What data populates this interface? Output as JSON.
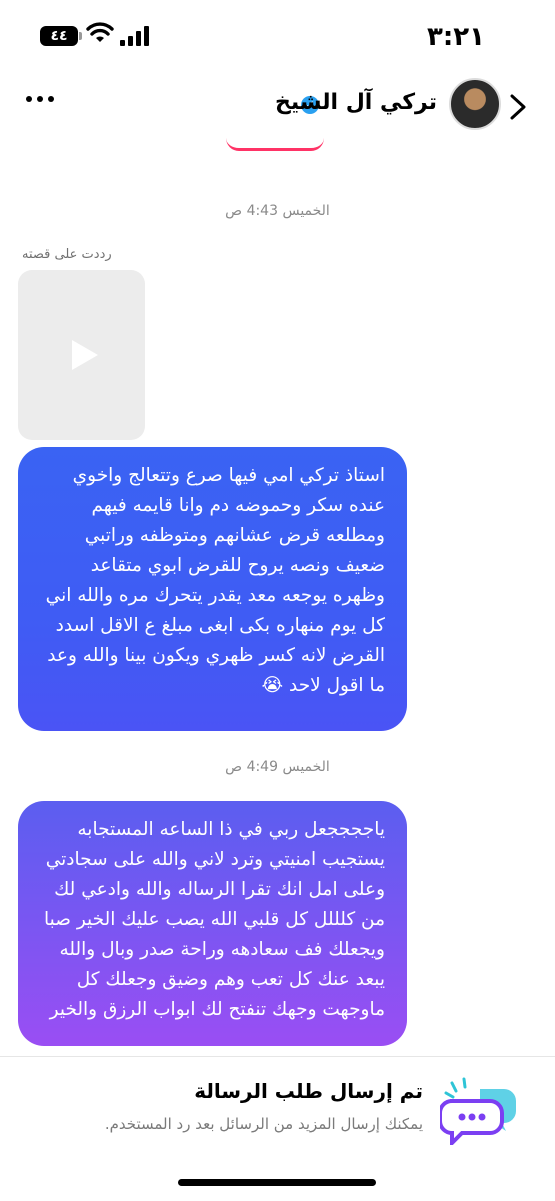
{
  "status_bar": {
    "time": "٣:٢١",
    "battery": "٤٤"
  },
  "header": {
    "name": "تركي آل الشيخ"
  },
  "thread": {
    "timestamp_1": "الخميس 4:43 ص",
    "reply_label": "رددت على قصته",
    "message_1": "استاذ تركي امي فيها صرع وتتعالج واخوي عنده سكر وحموضه دم وانا‏ قايمه فيهم ومطلعه قرض عشانهم ومتوظفه وراتبي ضعيف ونصه يروح للقرض ابوي متقاعد وظهره يوجعه معد يقدر يتحرك مره والله اني كل يوم منهاره بكى ابغى مبلغ ع الاقل اسدد القرض لانه كسر ظهري ويكون بينا والله وعد ما اقول لاحد 😭",
    "timestamp_2": "الخميس 4:49 ص",
    "message_2": "ياججججعل ربي في ذا الساعه المستجابه يستجيب امنيتي وترد لاني والله على سجادتي وعلى امل انك تقرا الرساله والله وادعي لك من كلللل كل قلبي الله يصب عليك الخير صبا ويجعلك فف سعادهه وراحة صدر وبال والله يبعد عنك كل تعب وهم وضيق وجعلك كل ماوجهت وجهك تنفتح لك ابواب الرزق والخير"
  },
  "request_notice": {
    "title": "تم إرسال طلب الرسالة",
    "subtitle": "يمكنك إرسال المزيد من الرسائل بعد رد المستخدم."
  },
  "colors": {
    "bubble_top": "#3a63f3",
    "bubble_purple": "#9a4ef3",
    "accent_pink": "#ff3366",
    "verified": "#2aa0f0"
  }
}
